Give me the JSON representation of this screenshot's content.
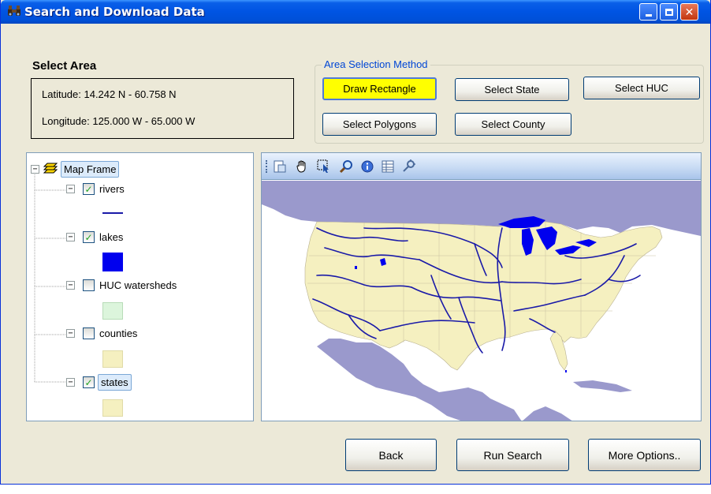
{
  "window": {
    "title": "Search and Download Data",
    "buttons": {
      "minimize": "_",
      "maximize": "□",
      "close": "✕"
    }
  },
  "select_area": {
    "title": "Select Area",
    "latitude": "Latitude:  14.242 N - 60.758 N",
    "longitude": "Longitude: 125.000 W - 65.000 W"
  },
  "area_selection": {
    "legend": "Area Selection Method",
    "buttons": {
      "draw_rectangle": "Draw Rectangle",
      "select_state": "Select State",
      "select_huc": "Select HUC",
      "select_polygons": "Select Polygons",
      "select_county": "Select County"
    },
    "active_color": "#ffff00"
  },
  "layers": {
    "frame_label": "Map Frame",
    "items": [
      {
        "label": "rivers",
        "checked": true,
        "swatch": "line",
        "color": "#1a1aa8"
      },
      {
        "label": "lakes",
        "checked": true,
        "swatch": "fill",
        "color": "#0000ee"
      },
      {
        "label": "HUC watersheds",
        "checked": false,
        "swatch": "fill",
        "color": "#dcf5dc"
      },
      {
        "label": "counties",
        "checked": false,
        "swatch": "fill",
        "color": "#f5f0c0"
      },
      {
        "label": "states",
        "checked": true,
        "swatch": "fill",
        "color": "#f5f0c0"
      }
    ],
    "check_mark": "✓"
  },
  "map": {
    "toolbar_icons": [
      "export-icon",
      "pan-hand-icon",
      "select-features-icon",
      "zoom-icon",
      "identify-icon",
      "attribute-table-icon",
      "settings-icon"
    ],
    "ocean_color": "#9a99cc",
    "land_color": "#f5f0c0",
    "water_color": "#0000ee"
  },
  "footer": {
    "back": "Back",
    "run_search": "Run Search",
    "more_options": "More Options.."
  }
}
